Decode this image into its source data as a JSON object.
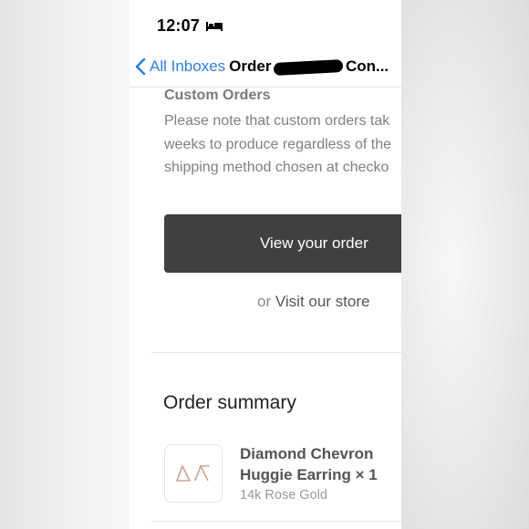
{
  "status_bar": {
    "time": "12:07",
    "focus_icon": "bed-icon"
  },
  "nav": {
    "back_label": "All Inboxes",
    "title_prefix": "Order",
    "title_suffix": "Con..."
  },
  "email": {
    "custom_orders": {
      "heading": "Custom Orders",
      "lines": [
        "Please note that custom orders tak",
        "weeks to produce regardless of the",
        "shipping method chosen at checko"
      ]
    },
    "view_order_button": "View your order",
    "or_text": "or",
    "visit_store_link": "Visit our store",
    "order_summary": {
      "title": "Order summary",
      "item": {
        "name_lines": [
          "Diamond Chevron",
          "Huggie Earring × 1"
        ],
        "variant": "14k Rose Gold"
      }
    }
  },
  "colors": {
    "link_blue": "#2f7fd9",
    "button_dark": "#404040",
    "rose_gold": "#c9a38f"
  }
}
